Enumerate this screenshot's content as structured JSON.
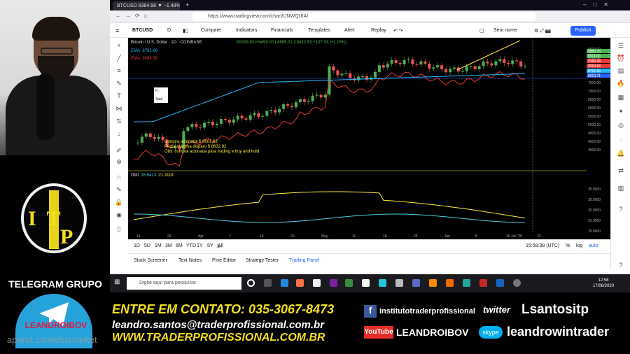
{
  "browser": {
    "tab_title": "BTCUSD 8384.98 ▼ −1.48% Se",
    "url": "https://www.tradingview.com/chart/UNWQUIA/"
  },
  "toolbar": {
    "symbol": "BTCUSD",
    "interval": "D",
    "compare": "Compare",
    "indicators": "Indicators",
    "financials": "Financials",
    "templates": "Templates",
    "alert": "Alert",
    "replay": "Replay",
    "layout": "Sem nome",
    "publish": "Publish"
  },
  "chart": {
    "legend_title": "Bitcoin / U.S. Dollar · 1D · COINBASE",
    "ohlc": "O9328.63 H9499.00 L8895.01 C9432.53 +107.53 (+1.15%)",
    "ema1_label": "EMA",
    "ema1_value": "8761.66",
    "ema2_label": "EMA",
    "ema2_value": "9094.58",
    "order_label_1": "P...",
    "order_label_2": "Stad",
    "annotation_1": "Compra acionada $ 9601,62",
    "annotation_2": "Perda máxima disparo $ 8632,92",
    "annotation_3": "Obs: compra acionada para trading e buy and hold",
    "dmi_label": "DMI",
    "dmi_value_1": "16.5413",
    "dmi_value_2": "21.3118",
    "price_ticks": [
      "9500.00",
      "9000.00",
      "8500.00",
      "8000.00",
      "7500.00",
      "7000.00",
      "6500.00",
      "6000.00",
      "5500.00",
      "5000.00",
      "4500.00",
      "4000.00",
      "3500.00"
    ],
    "price_tags": [
      "9985.76",
      "9511.00",
      "9384.98",
      "9094.58",
      "8761.66",
      "8613.71"
    ],
    "dmi_ticks": [
      "35.0000",
      "30.0000",
      "25.0000",
      "20.0000",
      "15.0000"
    ],
    "dates": [
      "16",
      "23",
      "Apr",
      "7",
      "13",
      "20",
      "May",
      "11",
      "18",
      "25",
      "Jun",
      "8",
      "15 Jun '20",
      "22"
    ],
    "colors": {
      "up": "#26a69a",
      "down": "#ef5350",
      "up_candle": "#4caf50",
      "ema_fast": "#e53935",
      "ema_slow": "#29b6f6",
      "dmi_a": "#ffeb3b",
      "dmi_b": "#4dd0e1"
    }
  },
  "bottom": {
    "ranges": [
      "1D",
      "5D",
      "1M",
      "3M",
      "6M",
      "YTD",
      "1Y",
      "5Y",
      "All"
    ],
    "time": "15:58:38 (UTC)",
    "pct": "%",
    "log": "log",
    "auto": "auto"
  },
  "panels": {
    "tab1": "Stock Screener",
    "tab2": "Text Notes",
    "tab3": "Pine Editor",
    "tab4": "Strategy Tester",
    "tab5": "Trading Panel"
  },
  "taskbar": {
    "search_placeholder": "Digite aqui para pesquisar",
    "time": "12:58",
    "date": "17/06/2020"
  },
  "overlay": {
    "telegram_title": "TELEGRAM GRUPO",
    "telegram_name": "LEANDROIBOV",
    "logo_letters": "ITP",
    "contact_line": "ENTRE EM CONTATO: 035-3067-8473",
    "email": "leandro.santos@traderprofissional.com.br",
    "site": "WWW.TRADERPROFISSIONAL.COM.BR",
    "facebook": "institutotraderprofissional",
    "twitter": "Lsantositp",
    "youtube": "LEANDROIBOV",
    "skype": "leandrowintrader",
    "watermark": "aparat.com/dssmarket"
  }
}
